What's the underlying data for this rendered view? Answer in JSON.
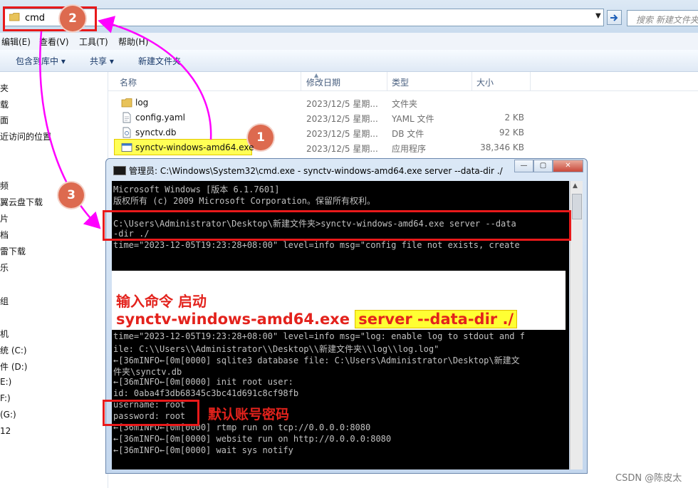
{
  "address_bar": {
    "path": "cmd",
    "search_placeholder": "搜索 新建文件夹"
  },
  "menu": [
    "编辑(E)",
    "查看(V)",
    "工具(T)",
    "帮助(H)"
  ],
  "toolbar": [
    "包含到库中 ▾",
    "共享 ▾",
    "新建文件夹"
  ],
  "nav": [
    "夹",
    "载",
    "面",
    "近访问的位置",
    "频",
    "翼云盘下载",
    "片",
    "档",
    "雷下载",
    "乐",
    "组",
    "机",
    "统 (C:)",
    "件 (D:)",
    "E:)",
    "F:)",
    "(G:)",
    "12"
  ],
  "columns": {
    "name": "名称",
    "date": "修改日期",
    "type": "类型",
    "size": "大小"
  },
  "files": [
    {
      "name": "log",
      "date": "2023/12/5 星期...",
      "type": "文件夹",
      "size": "",
      "icon": "folder-icon"
    },
    {
      "name": "config.yaml",
      "date": "2023/12/5 星期...",
      "type": "YAML 文件",
      "size": "2 KB",
      "icon": "yaml-file-icon"
    },
    {
      "name": "synctv.db",
      "date": "2023/12/5 星期...",
      "type": "DB 文件",
      "size": "92 KB",
      "icon": "db-file-icon"
    },
    {
      "name": "synctv-windows-amd64.exe",
      "date": "2023/12/5 星期...",
      "type": "应用程序",
      "size": "38,346 KB",
      "icon": "exe-file-icon"
    }
  ],
  "cmd": {
    "title": "管理员: C:\\Windows\\System32\\cmd.exe - synctv-windows-amd64.exe  server --data-dir ./",
    "lines_top": [
      "Microsoft Windows [版本 6.1.7601]",
      "版权所有 (c) 2009 Microsoft Corporation。保留所有权利。",
      "",
      "C:\\Users\\Administrator\\Desktop\\新建文件夹>synctv-windows-amd64.exe server --data",
      "-dir ./",
      "time=\"2023-12-05T19:23:28+08:00\" level=info msg=\"config file not exists, create"
    ],
    "lines_bottom": [
      "time=\"2023-12-05T19:23:28+08:00\" level=info msg=\"log: enable log to stdout and f",
      "ile: C:\\\\Users\\\\Administrator\\\\Desktop\\\\新建文件夹\\\\log\\\\log.log\"",
      "←[36mINFO←[0m[0000] sqlite3 database file: C:\\Users\\Administrator\\Desktop\\新建文",
      "件夹\\synctv.db",
      "←[36mINFO←[0m[0000] init root user:",
      "id: 0aba4f3db68345c3bc41d691c8cf98fb",
      "username: root",
      "password: root",
      "←[36mINFO←[0m[0000] rtmp run on tcp://0.0.0.0:8080",
      "←[36mINFO←[0m[0000] website run on http://0.0.0.0:8080",
      "←[36mINFO←[0m[0000] wait sys notify"
    ]
  },
  "annotation": {
    "line1": "输入命令 启动",
    "line2_prefix": "synctv-windows-amd64.exe ",
    "line2_highlight": "server --data-dir ./",
    "credentials_note": "默认账号密码"
  },
  "badges": [
    "1",
    "2",
    "3"
  ],
  "watermark": "CSDN @陈皮太",
  "colors": {
    "annotation_red": "#e8191a",
    "badge": "#dd6a4f",
    "highlight": "#ffff33",
    "arrow": "#ff00ff"
  }
}
